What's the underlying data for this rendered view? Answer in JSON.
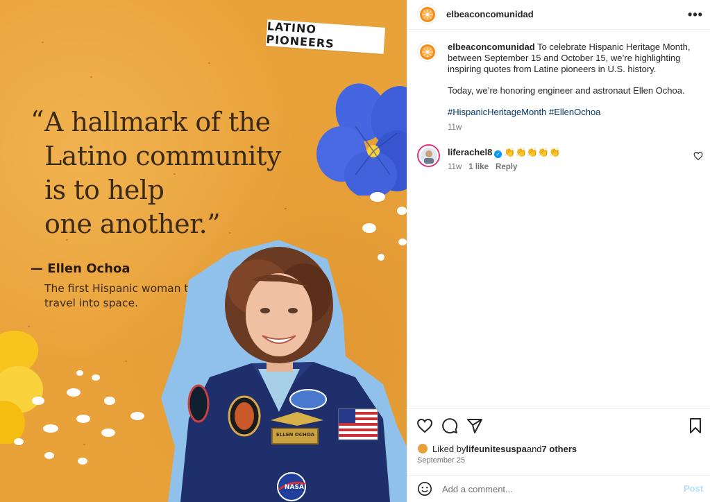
{
  "post_image": {
    "tag": "LATINO PIONEERS",
    "quote_open": "“",
    "quote_lines": [
      "A hallmark of the",
      "Latino community",
      "is to help",
      "one another.”"
    ],
    "author": "— Ellen Ochoa",
    "author_description": "The first Hispanic woman to travel into space.",
    "name_patch": "ELLEN OCHOA",
    "nasa_patch": "NASA"
  },
  "header": {
    "username": "elbeaconcomunidad",
    "avatar_icon": "orange-slice-icon",
    "more_icon": "more-options-icon"
  },
  "caption": {
    "username": "elbeaconcomunidad",
    "text_1": " To celebrate Hispanic Heritage Month, between September 15 and October 15, we’re highlighting inspiring quotes from Latine pioneers in U.S. history.",
    "text_2": "Today, we’re honoring engineer and astronaut Ellen Ochoa.",
    "hashtags": "#HispanicHeritageMonth #EllenOchoa",
    "time": "11w"
  },
  "comment": {
    "username": "liferachel8",
    "verified": "✓",
    "text": "👏👏👏👏👏",
    "time": "11w",
    "likes": "1 like",
    "reply": "Reply"
  },
  "likes": {
    "prefix": "Liked by ",
    "user": "lifeunitesuspa",
    "middle": " and ",
    "others": "7 others"
  },
  "post_date": "September 25",
  "comment_box": {
    "placeholder": "Add a comment...",
    "post_label": "Post"
  },
  "colors": {
    "background_orange": "#e9a23a",
    "flower_blue": "#3b5bd8",
    "flower_yellow": "#f7c51e",
    "suit_navy": "#1e2f6b",
    "link_blue": "#00376b",
    "verified_blue": "#0095f6"
  }
}
